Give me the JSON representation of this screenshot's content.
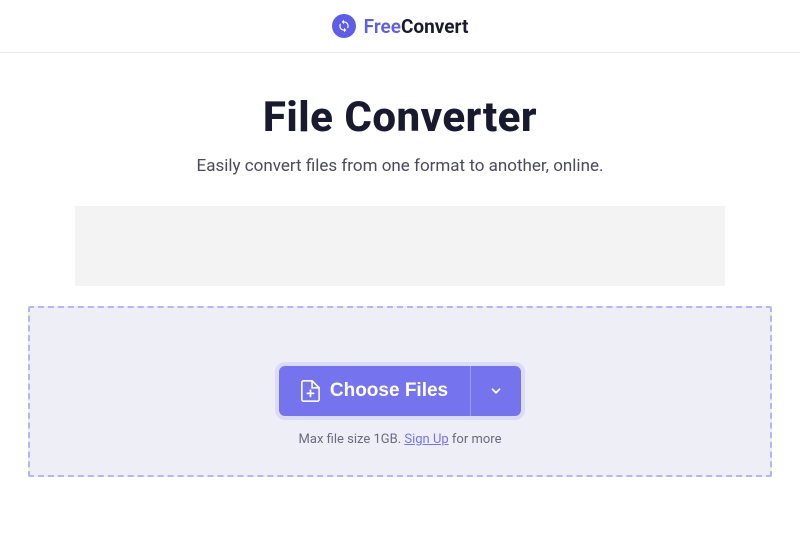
{
  "brand": {
    "name_part1": "Free",
    "name_part2": "Convert"
  },
  "hero": {
    "title": "File Converter",
    "subtitle": "Easily convert files from one format to another, online."
  },
  "upload": {
    "choose_label": "Choose Files",
    "hint_prefix": "Max file size 1GB. ",
    "signup_label": "Sign Up",
    "hint_suffix": " for more"
  },
  "colors": {
    "primary": "#7574ee",
    "logo": "#5e5de8",
    "text_dark": "#1a1a2e"
  }
}
